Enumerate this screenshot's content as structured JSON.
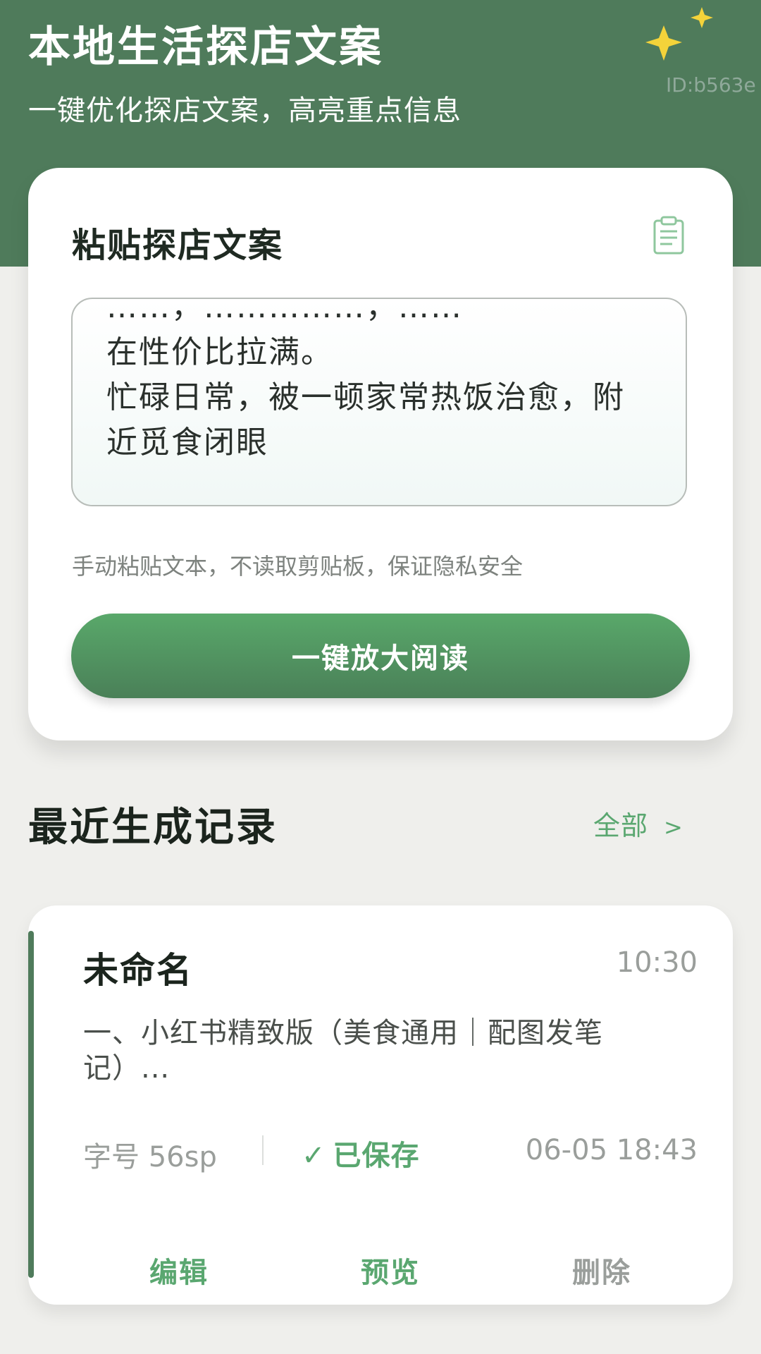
{
  "header": {
    "title": "本地生活探店文案",
    "subtitle": "一键优化探店文案，高亮重点信息",
    "id_label": "ID:b563e",
    "sparkle_icon": "sparkle-icon",
    "accent_color": "#4f7b5b"
  },
  "paste_card": {
    "title": "粘贴探店文案",
    "clipboard_icon": "clipboard-icon",
    "text_value": "……，……………，……\n在性价比拉满。\n忙碌日常，被一顿家常热饭治愈，附近觅食闭眼",
    "privacy_note": "手动粘贴文本，不读取剪贴板，保证隐私安全",
    "enlarge_button": "一键放大阅读",
    "button_color": "#59a86a"
  },
  "recent": {
    "section_title": "最近生成记录",
    "view_all_label": "全部",
    "view_all_chevron": ">",
    "records": [
      {
        "title": "未命名",
        "time": "10:30",
        "excerpt": "一、小红书精致版（美食通用｜配图发笔记）...",
        "font_size_label": "字号  56sp",
        "status_check": "✓",
        "status": "已保存",
        "saved_at": "06-05 18:43",
        "actions": {
          "edit": "编辑",
          "preview": "预览",
          "delete": "删除"
        }
      }
    ]
  }
}
